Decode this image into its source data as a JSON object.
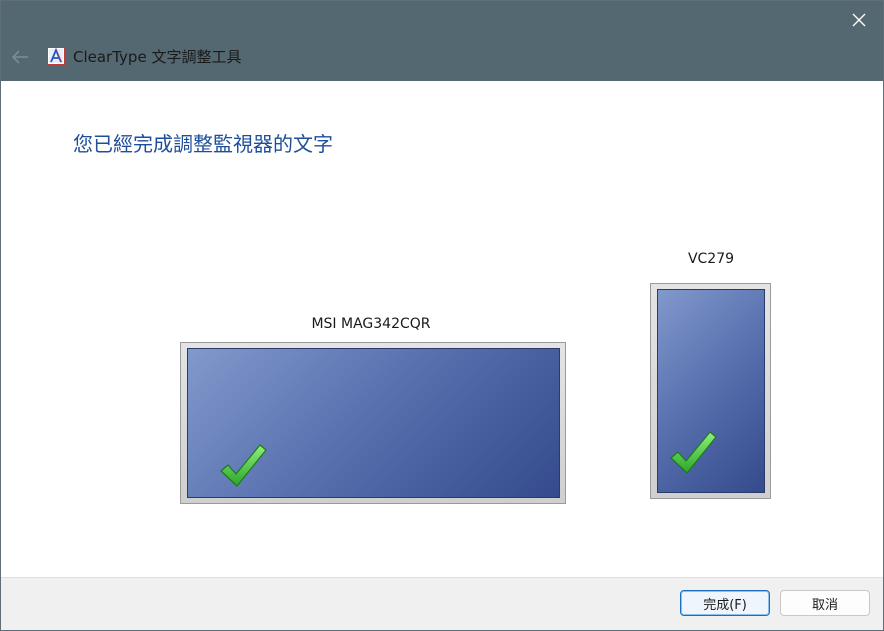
{
  "window": {
    "title": "ClearType 文字調整工具",
    "icons": {
      "close": "close-icon",
      "back": "back-arrow-icon",
      "app": "cleartype-app-icon"
    }
  },
  "content": {
    "heading": "您已經完成調整監視器的文字",
    "monitors": [
      {
        "name": "MSI MAG342CQR",
        "status": "check-mark-icon"
      },
      {
        "name": "VC279",
        "status": "check-mark-icon"
      }
    ]
  },
  "footer": {
    "finish_label": "完成(F)",
    "cancel_label": "取消"
  },
  "colors": {
    "titlebar": "#546872",
    "heading": "#1f4e9a",
    "screen_light": "#8299cc",
    "screen_dark": "#344a8c",
    "check": "#3fbf3a"
  }
}
